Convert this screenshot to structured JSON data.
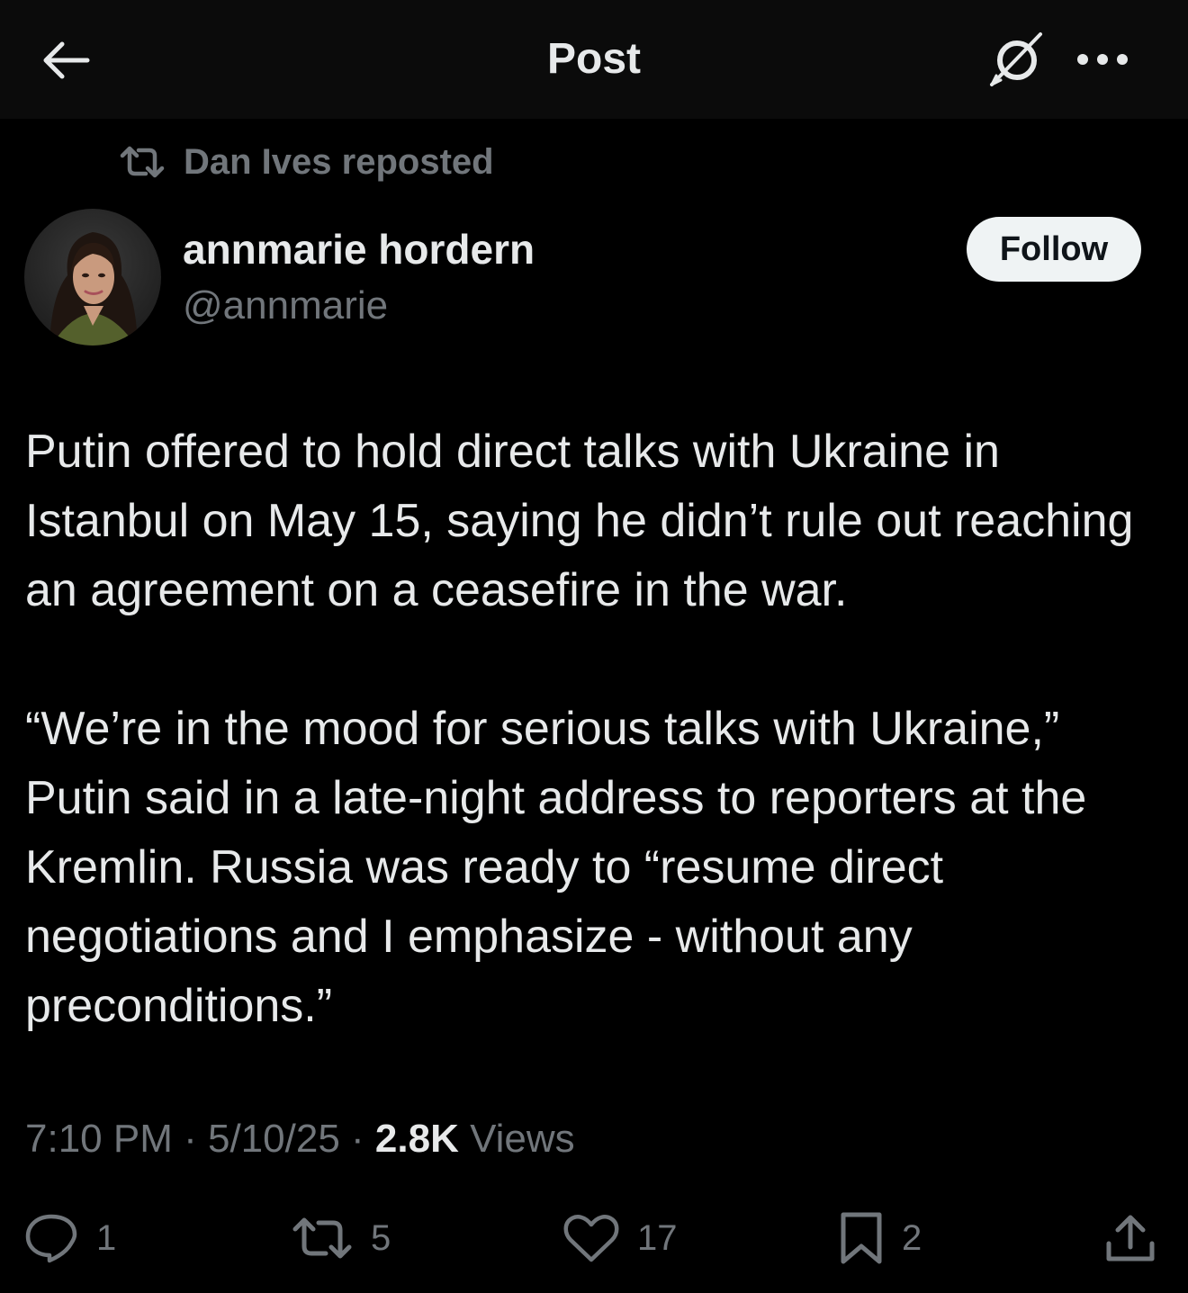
{
  "header": {
    "title": "Post",
    "back_icon": "arrow-left-icon",
    "grok_icon": "grok-icon",
    "more_icon": "more-horizontal-icon"
  },
  "repost": {
    "icon": "repost-icon",
    "label": "Dan Ives reposted"
  },
  "author": {
    "display_name": "annmarie hordern",
    "handle": "@annmarie",
    "avatar": "avatar-photo"
  },
  "follow_button": {
    "label": "Follow"
  },
  "post": {
    "paragraphs": [
      "Putin offered to hold direct talks with Ukraine in Istanbul on May 15, saying he didn’t rule out reaching an agreement on a ceasefire in the war.",
      "“We’re in the mood for serious talks with Ukraine,” Putin said in a late-night address to reporters at the Kremlin. Russia was ready to “resume direct negotiations and I emphasize - without any preconditions.”"
    ]
  },
  "meta": {
    "time": "7:10 PM",
    "separator": " · ",
    "date": "5/10/25",
    "views_count": "2.8K",
    "views_label": " Views"
  },
  "actions": {
    "replies": "1",
    "reposts": "5",
    "likes": "17",
    "bookmarks": "2"
  },
  "colors": {
    "background": "#000000",
    "header_background": "#0b0b0b",
    "primary_text": "#e7e9ea",
    "secondary_text": "#71767b",
    "follow_background": "#eff3f4",
    "follow_text": "#0f1419"
  }
}
